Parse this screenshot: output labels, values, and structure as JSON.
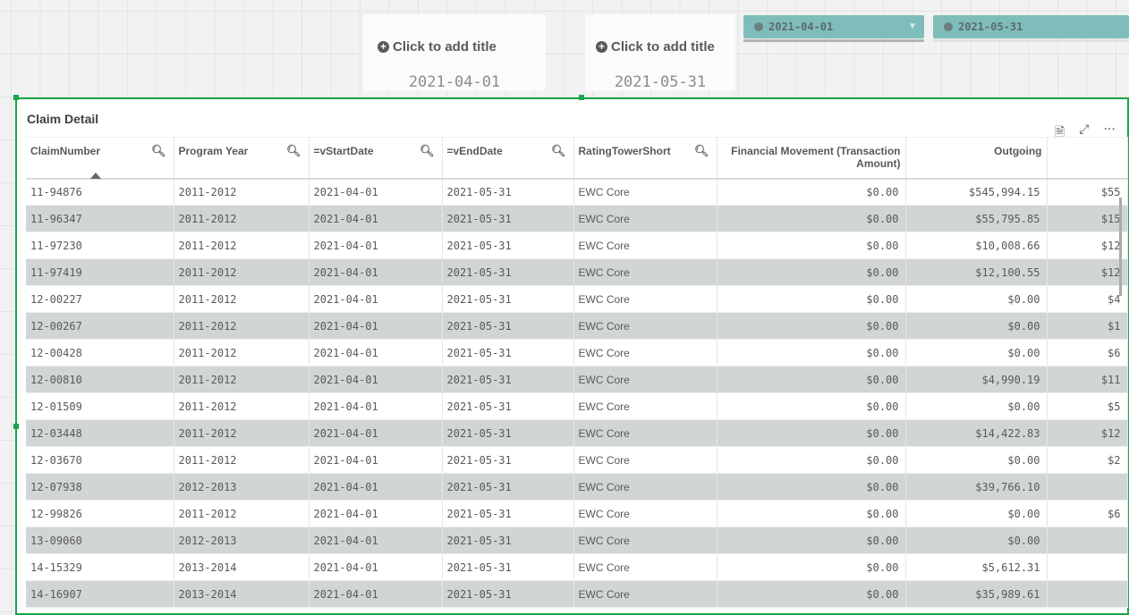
{
  "kpis": [
    {
      "title": "Click to add title",
      "value": "2021-04-01"
    },
    {
      "title": "Click to add title",
      "value": "2021-05-31"
    }
  ],
  "filters": [
    {
      "value": "2021-04-01"
    },
    {
      "value": "2021-05-31"
    }
  ],
  "panel": {
    "title": "Claim Detail"
  },
  "columns": [
    "ClaimNumber",
    "Program Year",
    "=vStartDate",
    "=vEndDate",
    "RatingTowerShort",
    "Financial Movement (Transaction Amount)",
    "Outgoing",
    ""
  ],
  "rows": [
    [
      "11-94876",
      "2011-2012",
      "2021-04-01",
      "2021-05-31",
      "EWC Core",
      "$0.00",
      "$545,994.15",
      "$55"
    ],
    [
      "11-96347",
      "2011-2012",
      "2021-04-01",
      "2021-05-31",
      "EWC Core",
      "$0.00",
      "$55,795.85",
      "$15"
    ],
    [
      "11-97230",
      "2011-2012",
      "2021-04-01",
      "2021-05-31",
      "EWC Core",
      "$0.00",
      "$10,008.66",
      "$12"
    ],
    [
      "11-97419",
      "2011-2012",
      "2021-04-01",
      "2021-05-31",
      "EWC Core",
      "$0.00",
      "$12,100.55",
      "$12"
    ],
    [
      "12-00227",
      "2011-2012",
      "2021-04-01",
      "2021-05-31",
      "EWC Core",
      "$0.00",
      "$0.00",
      "$4"
    ],
    [
      "12-00267",
      "2011-2012",
      "2021-04-01",
      "2021-05-31",
      "EWC Core",
      "$0.00",
      "$0.00",
      "$1"
    ],
    [
      "12-00428",
      "2011-2012",
      "2021-04-01",
      "2021-05-31",
      "EWC Core",
      "$0.00",
      "$0.00",
      "$6"
    ],
    [
      "12-00810",
      "2011-2012",
      "2021-04-01",
      "2021-05-31",
      "EWC Core",
      "$0.00",
      "$4,990.19",
      "$11"
    ],
    [
      "12-01509",
      "2011-2012",
      "2021-04-01",
      "2021-05-31",
      "EWC Core",
      "$0.00",
      "$0.00",
      "$5"
    ],
    [
      "12-03448",
      "2011-2012",
      "2021-04-01",
      "2021-05-31",
      "EWC Core",
      "$0.00",
      "$14,422.83",
      "$12"
    ],
    [
      "12-03670",
      "2011-2012",
      "2021-04-01",
      "2021-05-31",
      "EWC Core",
      "$0.00",
      "$0.00",
      "$2"
    ],
    [
      "12-07938",
      "2012-2013",
      "2021-04-01",
      "2021-05-31",
      "EWC Core",
      "$0.00",
      "$39,766.10",
      ""
    ],
    [
      "12-99826",
      "2011-2012",
      "2021-04-01",
      "2021-05-31",
      "EWC Core",
      "$0.00",
      "$0.00",
      "$6"
    ],
    [
      "13-09060",
      "2012-2013",
      "2021-04-01",
      "2021-05-31",
      "EWC Core",
      "$0.00",
      "$0.00",
      ""
    ],
    [
      "14-15329",
      "2013-2014",
      "2021-04-01",
      "2021-05-31",
      "EWC Core",
      "$0.00",
      "$5,612.31",
      ""
    ],
    [
      "14-16907",
      "2013-2014",
      "2021-04-01",
      "2021-05-31",
      "EWC Core",
      "$0.00",
      "$35,989.61",
      ""
    ]
  ]
}
